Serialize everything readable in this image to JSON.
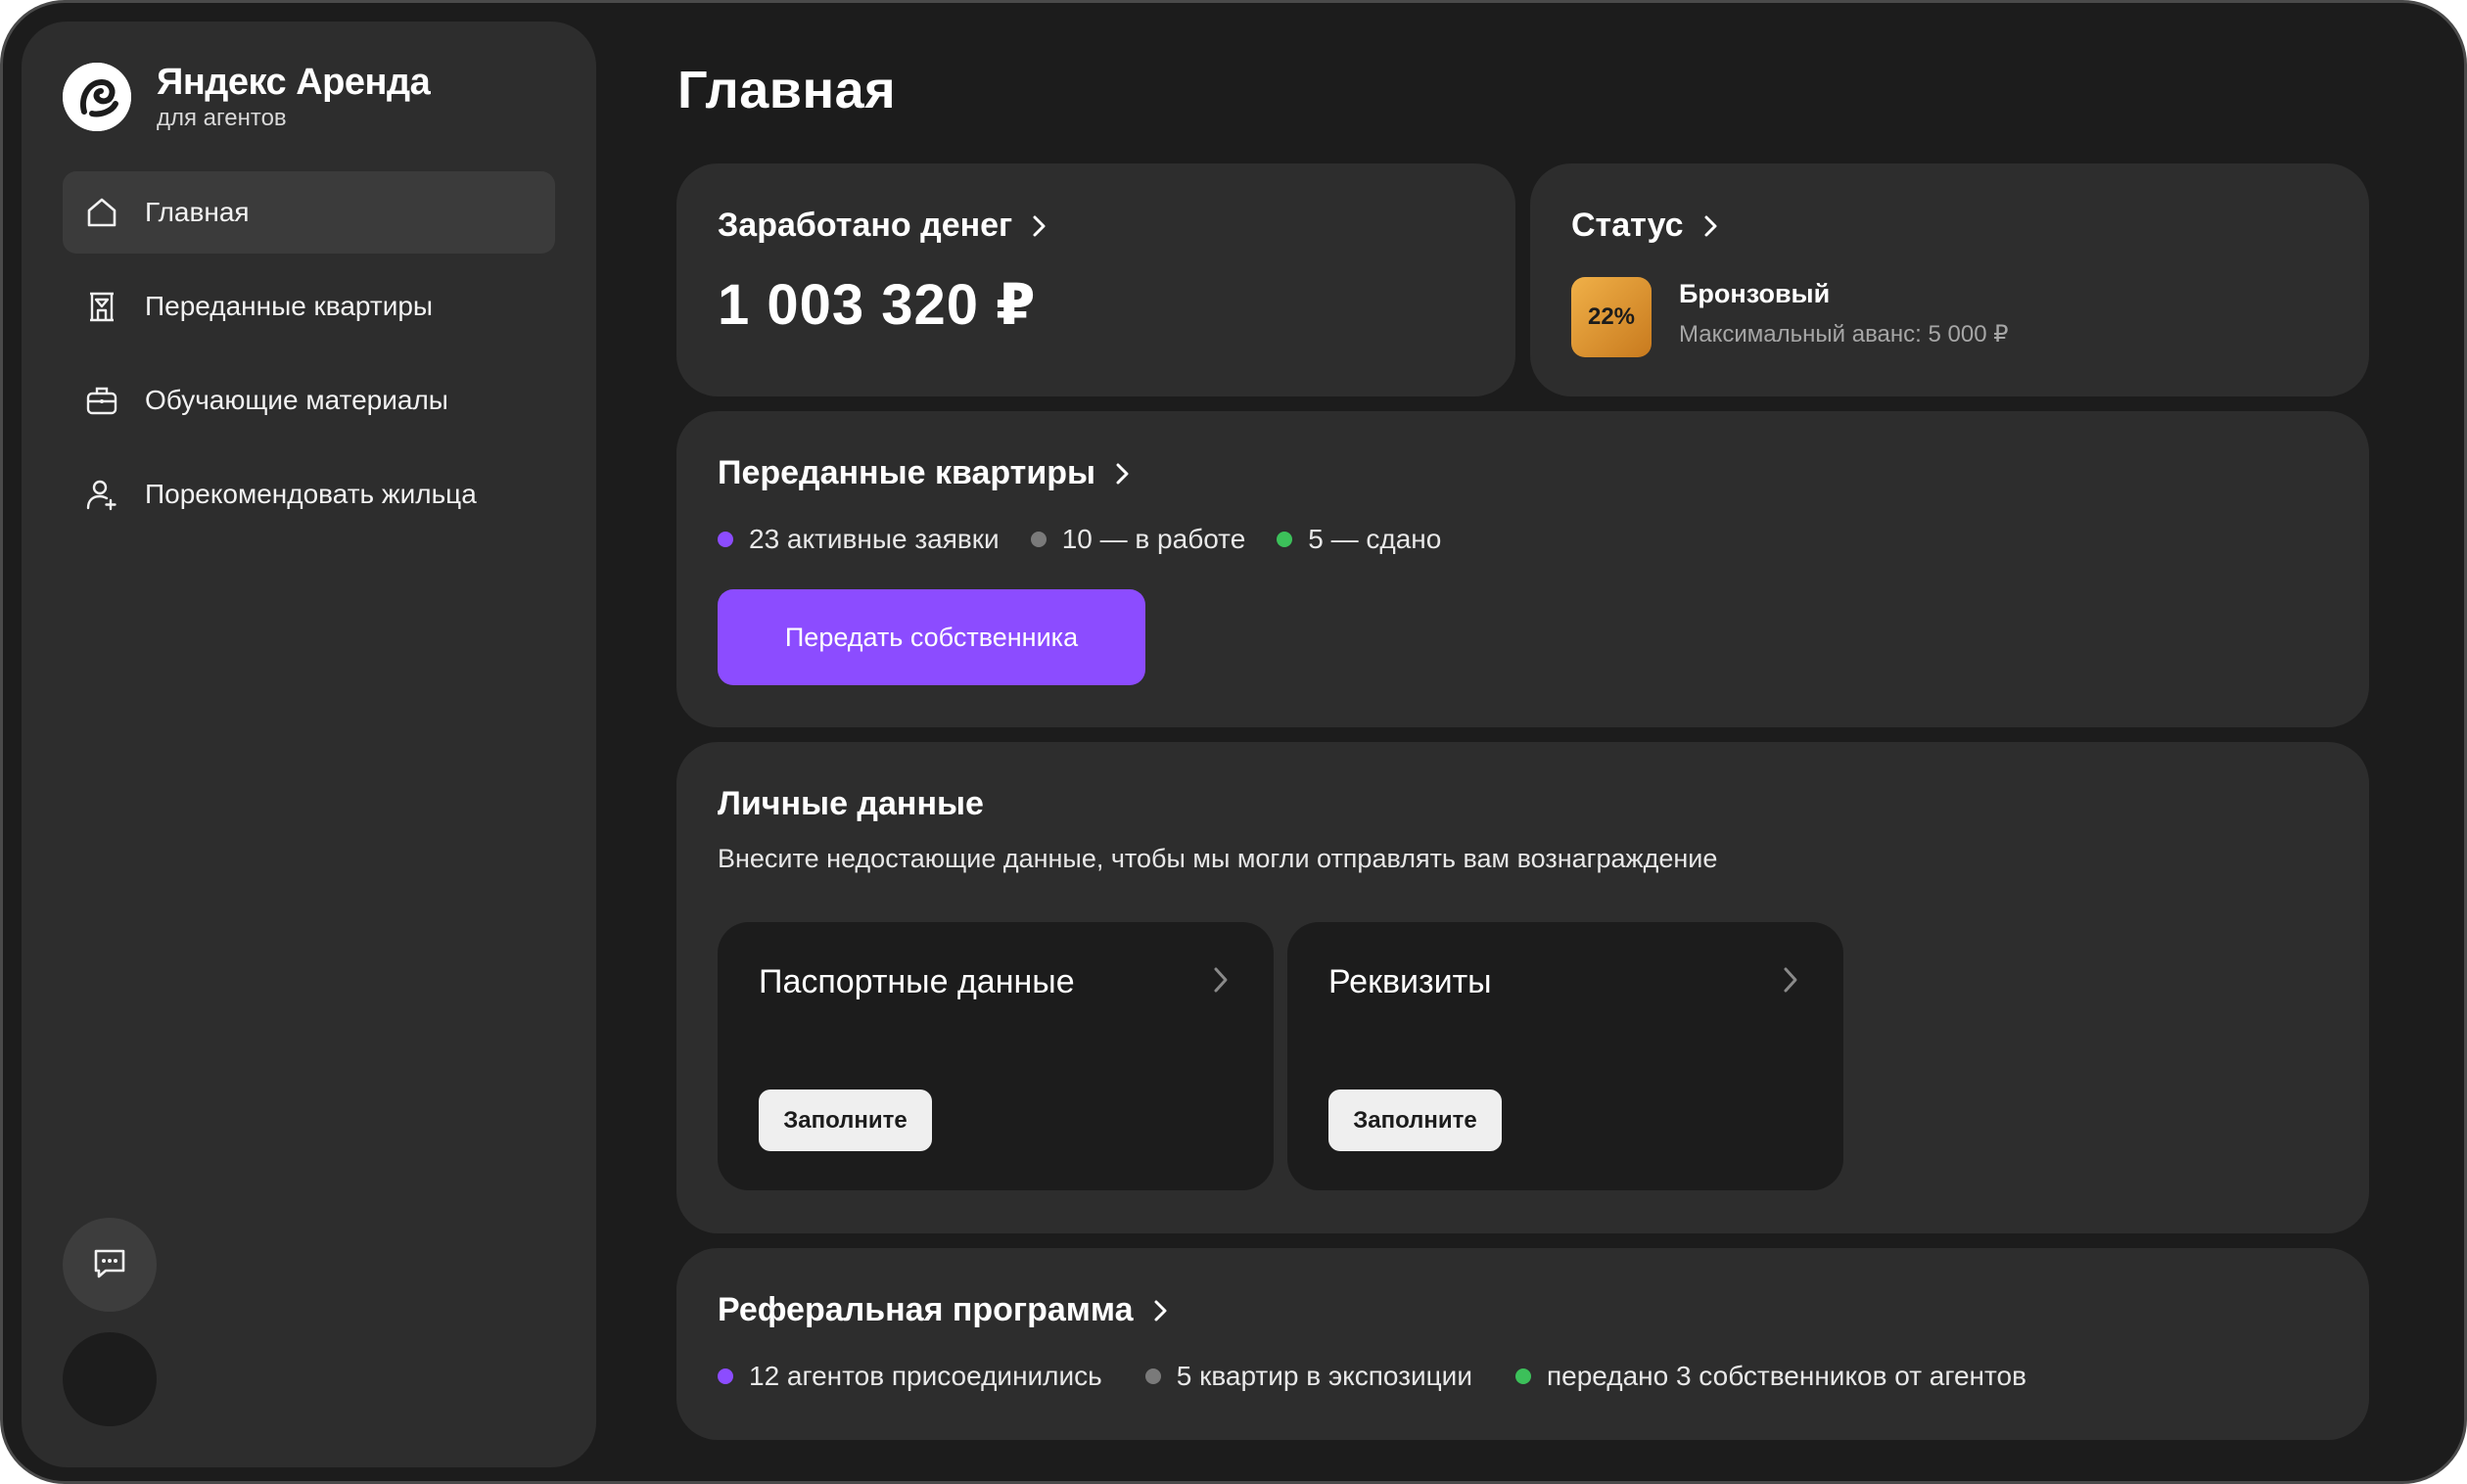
{
  "brand": {
    "name": "Яндекс Аренда",
    "subtitle": "для агентов"
  },
  "sidebar": {
    "items": [
      {
        "label": "Главная",
        "icon": "home-icon",
        "active": true
      },
      {
        "label": "Переданные квартиры",
        "icon": "building-icon",
        "active": false
      },
      {
        "label": "Обучающие материалы",
        "icon": "briefcase-icon",
        "active": false
      },
      {
        "label": "Порекомендовать жильца",
        "icon": "add-user-icon",
        "active": false
      }
    ],
    "chat_icon": "chat-icon"
  },
  "page": {
    "title": "Главная"
  },
  "earned": {
    "title": "Заработано денег",
    "amount": "1 003 320 ₽"
  },
  "status": {
    "title": "Статус",
    "percent": "22%",
    "level": "Бронзовый",
    "advance": "Максимальный аванс: 5 000 ₽",
    "badge_colors": [
      "#f0b048",
      "#c87a1e"
    ]
  },
  "apartments": {
    "title": "Переданные квартиры",
    "stats": [
      {
        "text": "23 активные заявки",
        "color": "#8c4cff"
      },
      {
        "text": "10 — в работе",
        "color": "#7a7a7a"
      },
      {
        "text": "5 — сдано",
        "color": "#3cc05a"
      }
    ],
    "button_label": "Передать собственника"
  },
  "personal": {
    "title": "Личные данные",
    "description": "Внесите недостающие данные, чтобы мы могли отправлять вам вознаграждение",
    "cards": [
      {
        "title": "Паспортные данные",
        "button": "Заполните"
      },
      {
        "title": "Реквизиты",
        "button": "Заполните"
      }
    ]
  },
  "referral": {
    "title": "Реферальная программа",
    "stats": [
      {
        "text": "12 агентов присоединились",
        "color": "#8c4cff"
      },
      {
        "text": "5 квартир в экспозиции",
        "color": "#7a7a7a"
      },
      {
        "text": "передано 3 собственников от агентов",
        "color": "#3cc05a"
      }
    ]
  },
  "colors": {
    "background": "#1c1c1c",
    "card": "#2d2d2d",
    "accent": "#8c4cff"
  }
}
